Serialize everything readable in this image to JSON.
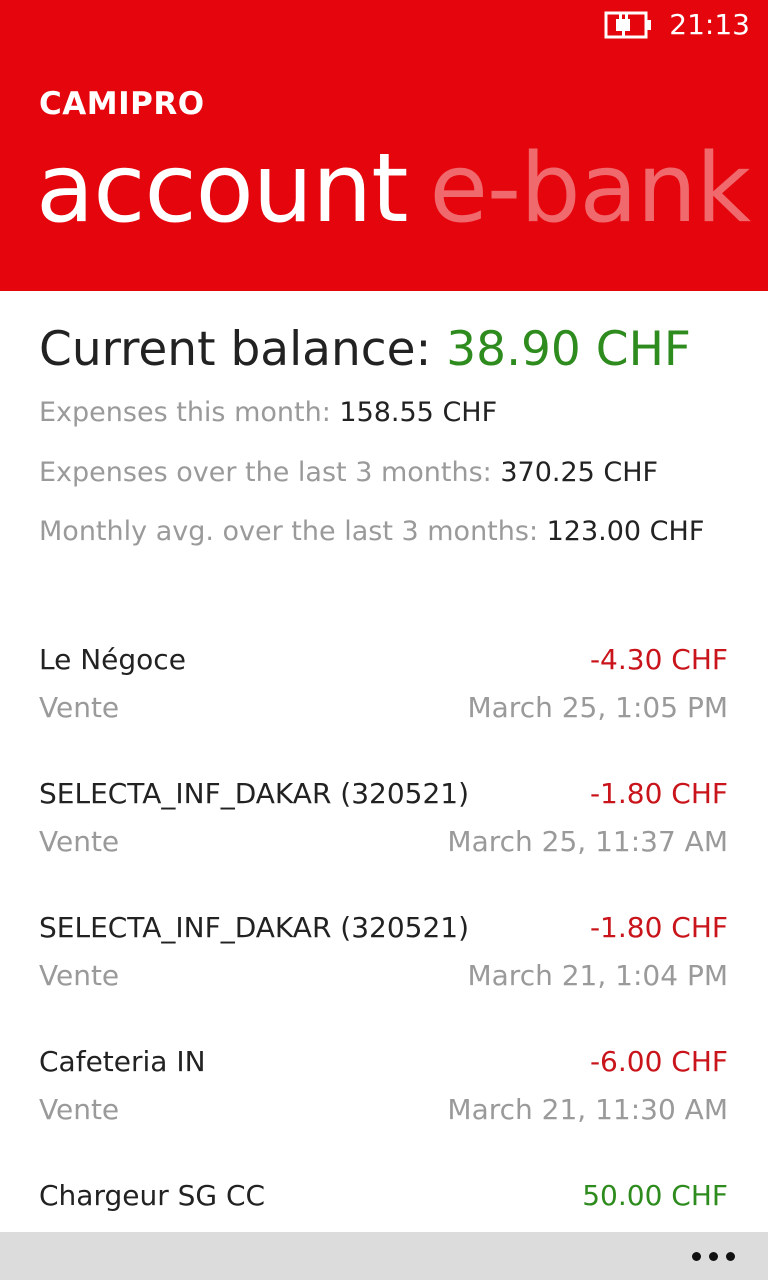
{
  "status": {
    "time": "21:13"
  },
  "header": {
    "app_title": "CAMIPRO",
    "pivot_active": "account",
    "pivot_next": "e-bank",
    "accent_color": "#e5060d"
  },
  "balance": {
    "label": "Current balance: ",
    "value": "38.90 CHF"
  },
  "stats": [
    {
      "label": "Expenses this month: ",
      "value": "158.55 CHF"
    },
    {
      "label": "Expenses over the last 3 months: ",
      "value": "370.25 CHF"
    },
    {
      "label": "Monthly avg. over the last 3 months: ",
      "value": "123.00 CHF"
    }
  ],
  "transactions": [
    {
      "name": "Le Négoce",
      "amount": "-4.30 CHF",
      "type": "Vente",
      "date": "March 25, 1:05 PM"
    },
    {
      "name": "SELECTA_INF_DAKAR (320521)",
      "amount": "-1.80 CHF",
      "type": "Vente",
      "date": "March 25, 11:37 AM"
    },
    {
      "name": "SELECTA_INF_DAKAR (320521)",
      "amount": "-1.80 CHF",
      "type": "Vente",
      "date": "March 21, 1:04 PM"
    },
    {
      "name": "Cafeteria IN",
      "amount": "-6.00 CHF",
      "type": "Vente",
      "date": "March 21, 11:30 AM"
    },
    {
      "name": "Chargeur SG CC",
      "amount": "50.00 CHF"
    }
  ],
  "appbar": {
    "more_icon": "ellipsis-icon"
  }
}
